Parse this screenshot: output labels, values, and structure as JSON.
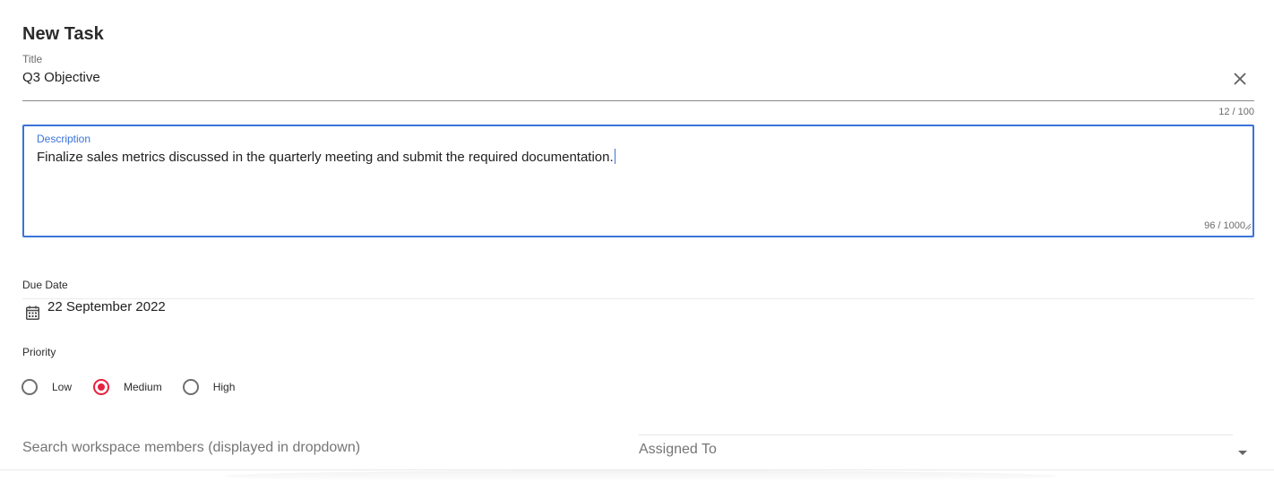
{
  "form": {
    "heading": "New Task",
    "title": {
      "label": "Title",
      "value": "Q3 Objective",
      "counter": "12 / 100",
      "clear_icon": "close-icon"
    },
    "description": {
      "label": "Description",
      "value": "Finalize sales metrics discussed in the quarterly meeting and submit the required documentation.",
      "counter": "96 / 1000"
    },
    "due_date": {
      "label": "Due Date",
      "value": "22 September 2022",
      "icon": "calendar-icon"
    },
    "priority": {
      "label": "Priority",
      "options": [
        {
          "label": "Low",
          "checked": false
        },
        {
          "label": "Medium",
          "checked": true
        },
        {
          "label": "High",
          "checked": false
        }
      ]
    },
    "members_search": {
      "placeholder": "Search workspace members (displayed in dropdown)"
    },
    "assigned_to": {
      "label": "Assigned To",
      "icon": "caret-down-icon"
    }
  },
  "colors": {
    "focus_blue": "#3b73d9",
    "radio_checked": "#e8213f"
  }
}
